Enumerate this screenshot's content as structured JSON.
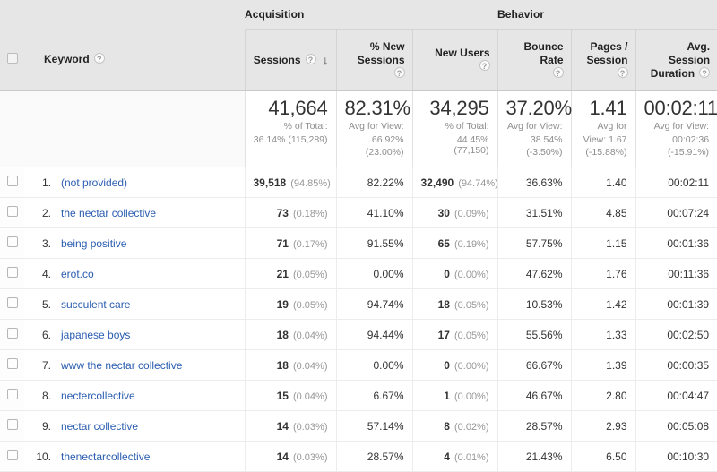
{
  "table": {
    "groups": [
      {
        "label": "",
        "span": 2
      },
      {
        "label": "Acquisition",
        "span": 3
      },
      {
        "label": "Behavior",
        "span": 3
      }
    ],
    "group_acquisition": "Acquisition",
    "group_behavior": "Behavior",
    "help_glyph": "?",
    "sort_arrow_glyph": "↓",
    "columns": {
      "keyword": "Keyword",
      "sessions": "Sessions",
      "pct_new_sessions": "% New\nSessions",
      "pct_new_sessions_line1": "% New",
      "pct_new_sessions_line2": "Sessions",
      "new_users": "New Users",
      "bounce_rate": "Bounce Rate",
      "pages_session_line1": "Pages /",
      "pages_session_line2": "Session",
      "avg_session_duration_line1": "Avg. Session",
      "avg_session_duration_line2": "Duration"
    },
    "summary": {
      "sessions": {
        "value": "41,664",
        "sub1": "% of Total:",
        "sub2": "36.14% (115,289)"
      },
      "pct_new_sessions": {
        "value": "82.31%",
        "sub1": "Avg for View:",
        "sub2": "66.92%",
        "sub3": "(23.00%)"
      },
      "new_users": {
        "value": "34,295",
        "sub1": "% of Total:",
        "sub2": "44.45% (77,150)"
      },
      "bounce_rate": {
        "value": "37.20%",
        "sub1": "Avg for View:",
        "sub2": "38.54%",
        "sub3": "(-3.50%)"
      },
      "pages_session": {
        "value": "1.41",
        "sub1": "Avg for",
        "sub2": "View: 1.67",
        "sub3": "(-15.88%)"
      },
      "avg_session_duration": {
        "value": "00:02:11",
        "sub1": "Avg for View:",
        "sub2": "00:02:36",
        "sub3": "(-15.91%)"
      }
    },
    "rows": [
      {
        "num": "1.",
        "keyword": "(not provided)",
        "sessions": "39,518",
        "sessions_pct": "(94.85%)",
        "pct_new_sessions": "82.22%",
        "new_users": "32,490",
        "new_users_pct": "(94.74%)",
        "bounce_rate": "36.63%",
        "pages_session": "1.40",
        "avg_session_duration": "00:02:11"
      },
      {
        "num": "2.",
        "keyword": "the nectar collective",
        "sessions": "73",
        "sessions_pct": "(0.18%)",
        "pct_new_sessions": "41.10%",
        "new_users": "30",
        "new_users_pct": "(0.09%)",
        "bounce_rate": "31.51%",
        "pages_session": "4.85",
        "avg_session_duration": "00:07:24"
      },
      {
        "num": "3.",
        "keyword": "being positive",
        "sessions": "71",
        "sessions_pct": "(0.17%)",
        "pct_new_sessions": "91.55%",
        "new_users": "65",
        "new_users_pct": "(0.19%)",
        "bounce_rate": "57.75%",
        "pages_session": "1.15",
        "avg_session_duration": "00:01:36"
      },
      {
        "num": "4.",
        "keyword": "erot.co",
        "sessions": "21",
        "sessions_pct": "(0.05%)",
        "pct_new_sessions": "0.00%",
        "new_users": "0",
        "new_users_pct": "(0.00%)",
        "bounce_rate": "47.62%",
        "pages_session": "1.76",
        "avg_session_duration": "00:11:36"
      },
      {
        "num": "5.",
        "keyword": "succulent care",
        "sessions": "19",
        "sessions_pct": "(0.05%)",
        "pct_new_sessions": "94.74%",
        "new_users": "18",
        "new_users_pct": "(0.05%)",
        "bounce_rate": "10.53%",
        "pages_session": "1.42",
        "avg_session_duration": "00:01:39"
      },
      {
        "num": "6.",
        "keyword": "japanese boys",
        "sessions": "18",
        "sessions_pct": "(0.04%)",
        "pct_new_sessions": "94.44%",
        "new_users": "17",
        "new_users_pct": "(0.05%)",
        "bounce_rate": "55.56%",
        "pages_session": "1.33",
        "avg_session_duration": "00:02:50"
      },
      {
        "num": "7.",
        "keyword": "www the nectar collective",
        "sessions": "18",
        "sessions_pct": "(0.04%)",
        "pct_new_sessions": "0.00%",
        "new_users": "0",
        "new_users_pct": "(0.00%)",
        "bounce_rate": "66.67%",
        "pages_session": "1.39",
        "avg_session_duration": "00:00:35"
      },
      {
        "num": "8.",
        "keyword": "nectercollective",
        "sessions": "15",
        "sessions_pct": "(0.04%)",
        "pct_new_sessions": "6.67%",
        "new_users": "1",
        "new_users_pct": "(0.00%)",
        "bounce_rate": "46.67%",
        "pages_session": "2.80",
        "avg_session_duration": "00:04:47"
      },
      {
        "num": "9.",
        "keyword": "nectar collective",
        "sessions": "14",
        "sessions_pct": "(0.03%)",
        "pct_new_sessions": "57.14%",
        "new_users": "8",
        "new_users_pct": "(0.02%)",
        "bounce_rate": "28.57%",
        "pages_session": "2.93",
        "avg_session_duration": "00:05:08"
      },
      {
        "num": "10.",
        "keyword": "thenectarcollective",
        "sessions": "14",
        "sessions_pct": "(0.03%)",
        "pct_new_sessions": "28.57%",
        "new_users": "4",
        "new_users_pct": "(0.01%)",
        "bounce_rate": "21.43%",
        "pages_session": "6.50",
        "avg_session_duration": "00:10:30"
      }
    ]
  },
  "colors": {
    "link": "#2a5db0",
    "header_bg": "#e6e6e6",
    "muted_text": "#979797"
  }
}
